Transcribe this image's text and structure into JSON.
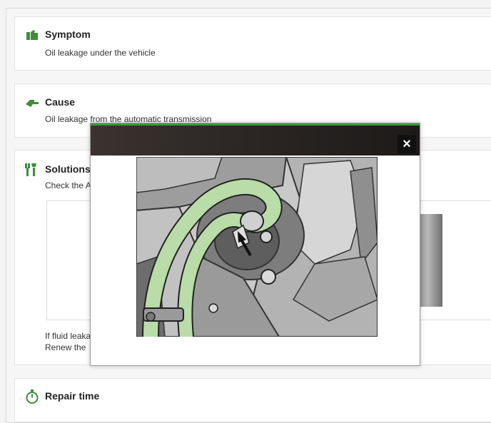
{
  "symptom": {
    "title": "Symptom",
    "text": "Oil leakage under the vehicle"
  },
  "cause": {
    "title": "Cause",
    "text": "Oil leakage from the automatic transmission"
  },
  "solutions": {
    "title": "Solutions",
    "text": "Check the A",
    "line1": "If fluid leaka",
    "line2": "Renew the"
  },
  "repair_time": {
    "title": "Repair time"
  },
  "modal": {
    "close_glyph": "×"
  },
  "colors": {
    "accent": "#3a9a3a",
    "icon_green": "#3e8e3a",
    "hose_green": "#b9dca8"
  },
  "icons": [
    "thumbs-down-icon",
    "pointing-hand-icon",
    "tools-icon",
    "stopwatch-icon",
    "close-icon",
    "arrow-icon"
  ]
}
